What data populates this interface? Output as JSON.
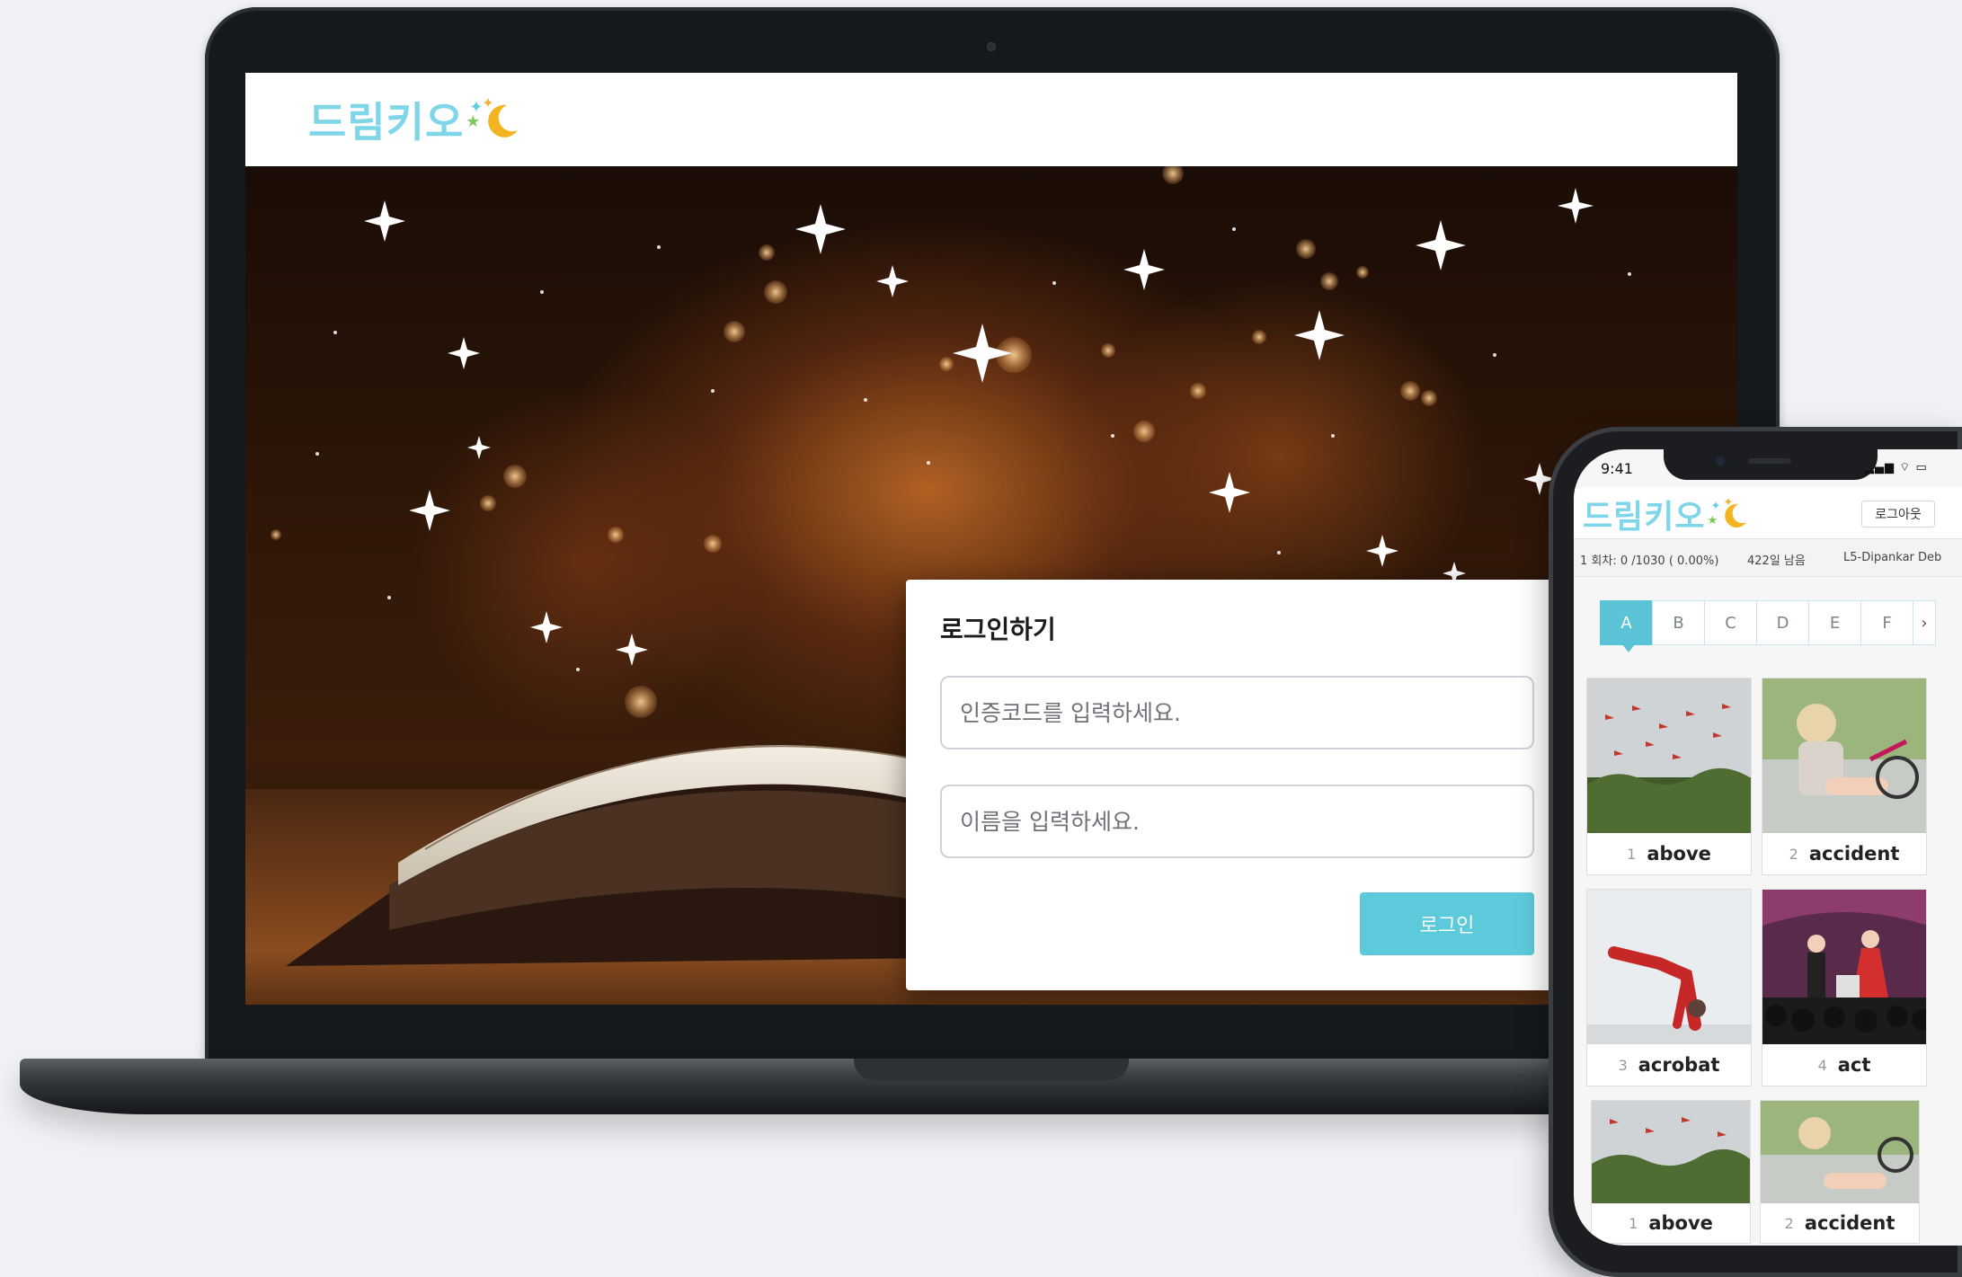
{
  "laptop": {
    "logo_text": "드림키오",
    "login": {
      "title": "로그인하기",
      "code_placeholder": "인증코드를 입력하세요.",
      "name_placeholder": "이름을 입력하세요.",
      "button_label": "로그인"
    }
  },
  "phone": {
    "status_time": "9:41",
    "status_icons": "▂▄▆ ⌔ ▭",
    "logo_text": "드림키오",
    "logout_label": "로그아웃",
    "info": {
      "progress": "1 회차: 0 /1030 ( 0.00%)",
      "days_left": "422일 남음",
      "user": "L5-Dipankar Deb"
    },
    "tabs": [
      "A",
      "B",
      "C",
      "D",
      "E",
      "F"
    ],
    "active_tab": "A",
    "tab_next": "›",
    "cards": [
      {
        "num": "1",
        "word": "above",
        "image": "flamingos-flying-over-forest"
      },
      {
        "num": "2",
        "word": "accident",
        "image": "girl-with-scraped-knee-and-bicycle"
      },
      {
        "num": "3",
        "word": "acrobat",
        "image": "acrobat-in-red-handstand"
      },
      {
        "num": "4",
        "word": "act",
        "image": "actors-on-stage"
      },
      {
        "num": "1",
        "word": "above",
        "image": "flamingos-flying-over-forest"
      },
      {
        "num": "2",
        "word": "accident",
        "image": "girl-with-scraped-knee-and-bicycle"
      }
    ]
  },
  "colors": {
    "accent": "#5bc3d6",
    "login_button": "#5ccadb",
    "logo": "#7fd6e8"
  }
}
